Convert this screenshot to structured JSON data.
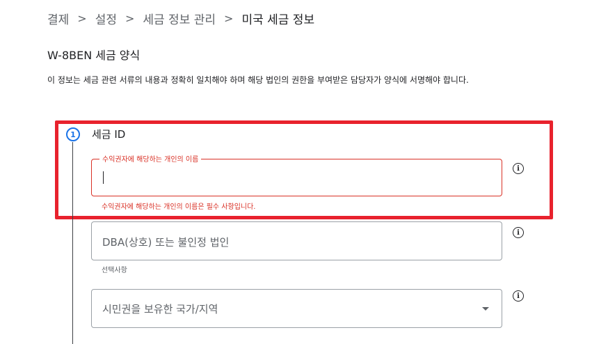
{
  "breadcrumb": {
    "items": [
      "결제",
      "설정",
      "세금 정보 관리"
    ],
    "current": "미국 세금 정보",
    "separator": ">"
  },
  "form": {
    "title": "W-8BEN 세금 양식",
    "description": "이 정보는 세금 관련 서류의 내용과 정확히 일치해야 하며 해당 법인의 권한을 부여받은 담당자가 양식에 서명해야 합니다."
  },
  "step": {
    "number": "1",
    "title": "세금 ID"
  },
  "fields": {
    "beneficiary_name": {
      "label": "수익권자에 해당하는 개인의 이름",
      "value": "",
      "error": "수익권자에 해당하는 개인의 이름은 필수 사항입니다."
    },
    "dba": {
      "placeholder": "DBA(상호) 또는 불인정 법인",
      "helper": "선택사항"
    },
    "country": {
      "placeholder": "시민권을 보유한 국가/지역"
    }
  },
  "icons": {
    "info": "i"
  },
  "colors": {
    "error": "#d93025",
    "highlight": "#e8222d",
    "accent": "#1a73e8"
  }
}
